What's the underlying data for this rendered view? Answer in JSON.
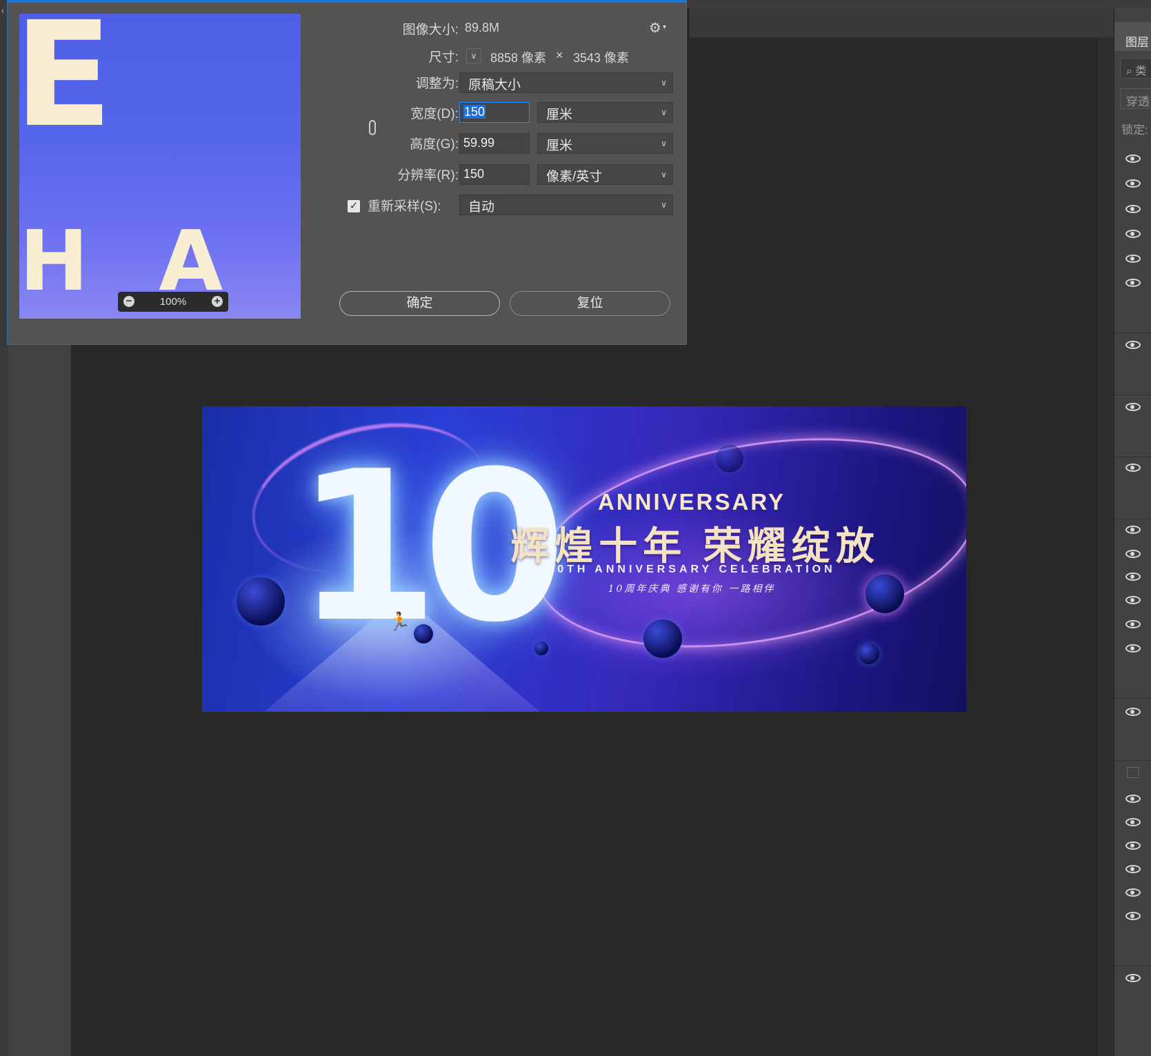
{
  "dialog": {
    "image_size_label": "图像大小:",
    "image_size_value": "89.8M",
    "dimensions_label": "尺寸:",
    "dimensions_width": "8858 像素",
    "dimensions_times": "×",
    "dimensions_height": "3543 像素",
    "fit_to_label": "调整为:",
    "fit_to_value": "原稿大小",
    "width_label": "宽度(D):",
    "width_value": "150",
    "width_unit": "厘米",
    "height_label": "高度(G):",
    "height_value": "59.99",
    "height_unit": "厘米",
    "resolution_label": "分辨率(R):",
    "resolution_value": "150",
    "resolution_unit": "像素/英寸",
    "resample_label": "重新采样(S):",
    "resample_checked": true,
    "resample_value": "自动",
    "ok_label": "确定",
    "reset_label": "复位",
    "preview_zoom": "100%",
    "preview_text_top": "E",
    "preview_text_bottom": "H A"
  },
  "banner": {
    "big_number": "10",
    "title_en": "ANNIVERSARY",
    "title_cn": "辉煌十年 荣耀绽放",
    "subtitle_en": "10TH ANNIVERSARY CELEBRATION",
    "subtitle_cn": "10周年庆典 感谢有你 一路相伴"
  },
  "layers_panel": {
    "tab_label": "图层",
    "search_placeholder": "类",
    "blend_mode": "穿透",
    "lock_label": "锁定:"
  },
  "icons": [
    "gear-icon",
    "chain-link-icon",
    "zoom-out-icon",
    "zoom-in-icon",
    "eye-icon",
    "search-icon",
    "checkbox-icon",
    "chevron-down-icon"
  ]
}
